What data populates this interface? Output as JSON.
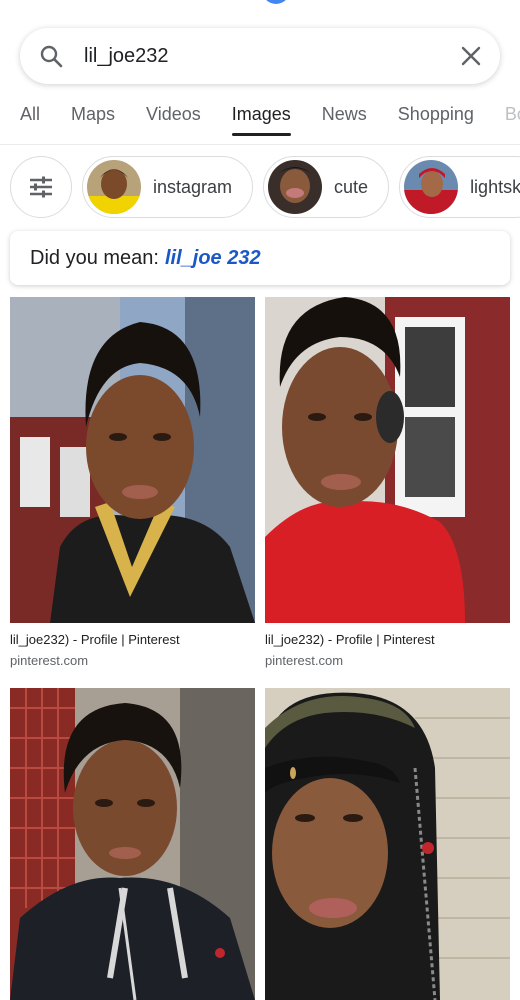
{
  "search": {
    "query": "lil_joe232"
  },
  "tabs": [
    {
      "label": "All",
      "active": false
    },
    {
      "label": "Maps",
      "active": false
    },
    {
      "label": "Videos",
      "active": false
    },
    {
      "label": "Images",
      "active": true
    },
    {
      "label": "News",
      "active": false
    },
    {
      "label": "Shopping",
      "active": false
    },
    {
      "label": "Bo",
      "active": false
    }
  ],
  "chips": [
    {
      "label": "instagram"
    },
    {
      "label": "cute"
    },
    {
      "label": "lightski"
    }
  ],
  "did_you_mean": {
    "prefix": "Did you mean:",
    "suggestion": "lil_joe 232"
  },
  "results": [
    {
      "caption": "lil_joe232) - Profile | Pinterest",
      "source": "pinterest.com"
    },
    {
      "caption": "lil_joe232) - Profile | Pinterest",
      "source": "pinterest.com"
    },
    {
      "caption": "",
      "source": ""
    },
    {
      "caption": "",
      "source": ""
    }
  ],
  "colors": {
    "accent_blue": "#1a57c8",
    "google_blue": "#4285f4",
    "tab_active": "#202124",
    "tab_inactive": "#5f6368"
  }
}
